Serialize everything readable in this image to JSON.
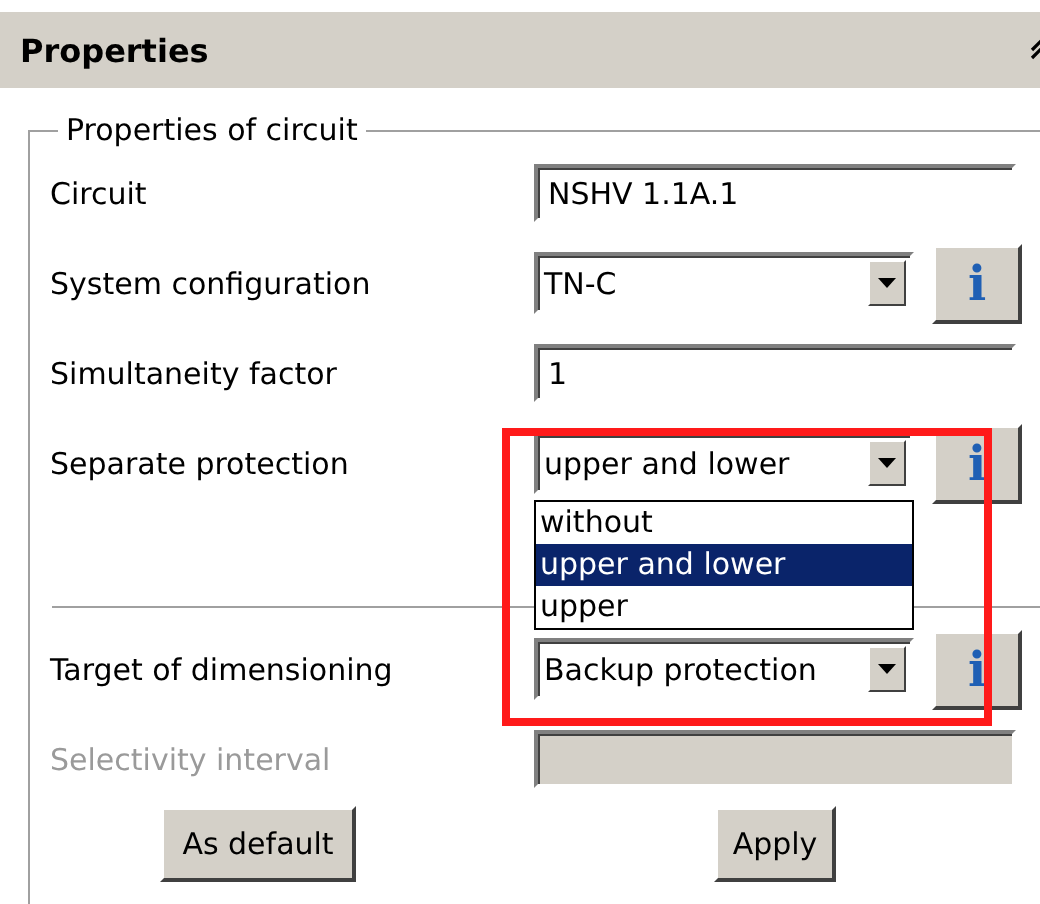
{
  "panel": {
    "title": "Properties"
  },
  "group": {
    "title": "Properties of circuit"
  },
  "fields": [
    {
      "kind": "text",
      "label": "Circuit",
      "value": "NSHV 1.1A.1",
      "disabled": false
    },
    {
      "kind": "combo",
      "label": "System configuration",
      "value": "TN-C",
      "info": "i"
    },
    {
      "kind": "text",
      "label": "Simultaneity factor",
      "value": "1",
      "disabled": false
    },
    {
      "kind": "combo",
      "label": "Separate protection",
      "value": "upper and lower",
      "info": "i",
      "expanded": true,
      "options": [
        {
          "label": "without",
          "selected": false
        },
        {
          "label": "upper and lower",
          "selected": true
        },
        {
          "label": "upper",
          "selected": false
        }
      ]
    },
    {
      "kind": "separator"
    },
    {
      "kind": "combo",
      "label": "Target of dimensioning",
      "value": "Backup protection",
      "info": "i"
    },
    {
      "kind": "text",
      "label": "Selectivity interval",
      "disabled": true
    }
  ],
  "buttons": [
    "As default",
    "Apply"
  ]
}
